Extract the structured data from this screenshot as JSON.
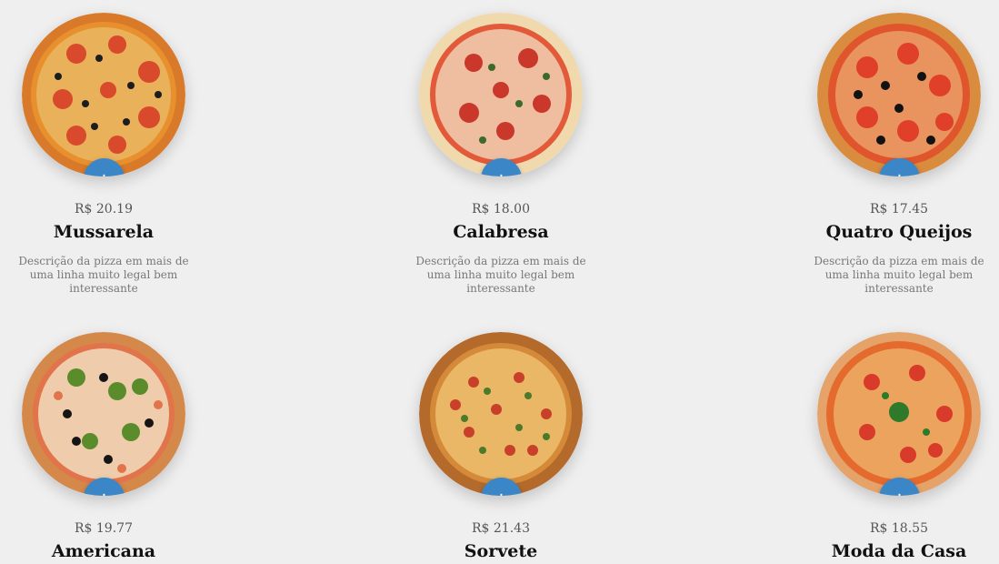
{
  "pizzas": [
    {
      "name": "Mussarela",
      "price": "R$ 20.19",
      "desc": "Descrição da pizza em mais de uma linha muito legal bem interessante",
      "add_label": "+",
      "crust": "#d9792a",
      "sauce": "#e8902e",
      "cheese": "#eab15b",
      "topping": "#d84a2b",
      "topping2": "#1d1d1d"
    },
    {
      "name": "Calabresa",
      "price": "R$ 18.00",
      "desc": "Descrição da pizza em mais de uma linha muito legal bem interessante",
      "add_label": "+",
      "crust": "#f1d9ae",
      "sauce": "#e35a3a",
      "cheese": "#f3e0c4",
      "topping": "#c9382a",
      "topping2": "#3a6b2a"
    },
    {
      "name": "Quatro Queijos",
      "price": "R$ 17.45",
      "desc": "Descrição da pizza em mais de uma linha muito legal bem interessante",
      "add_label": "+",
      "crust": "#d98b3e",
      "sauce": "#e0552c",
      "cheese": "#f1c98a",
      "topping": "#e0402a",
      "topping2": "#121212"
    },
    {
      "name": "Americana",
      "price": "R$ 19.77",
      "desc": "",
      "add_label": "+",
      "crust": "#d4884a",
      "sauce": "#e2744b",
      "cheese": "#f2e3c4",
      "topping": "#5b8c2c",
      "topping2": "#151515"
    },
    {
      "name": "Sorvete",
      "price": "R$ 21.43",
      "desc": "",
      "add_label": "+",
      "crust": "#b46a2a",
      "sauce": "#d58a3a",
      "cheese": "#e9b765",
      "topping": "#c8402a",
      "topping2": "#4b7a2a"
    },
    {
      "name": "Moda da Casa",
      "price": "R$ 18.55",
      "desc": "",
      "add_label": "+",
      "crust": "#e5a36a",
      "sauce": "#e46a2d",
      "cheese": "#f0c27a",
      "topping": "#d93b2a",
      "topping2": "#2f7a2a"
    }
  ]
}
